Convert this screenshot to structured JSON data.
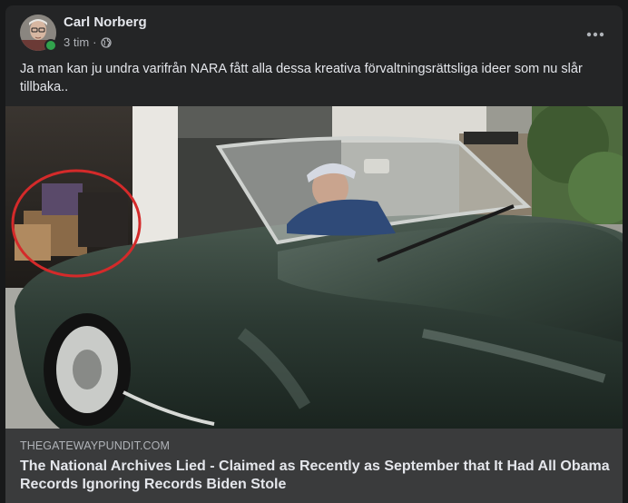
{
  "post": {
    "author": "Carl Norberg",
    "time": "3 tim",
    "separator": "·",
    "audience_icon": "globe-icon",
    "more_icon": "more-options-icon",
    "text": "Ja man kan ju undra varifrån NARA fått alla dessa kreativa förvaltningsrättsliga ideer som nu  slår tillbaka.."
  },
  "link_preview": {
    "domain": "THEGATEWAYPUNDIT.COM",
    "headline": "The National Archives Lied - Claimed as Recently as September that It Had All Obama Records Ignoring Records Biden Stole"
  },
  "colors": {
    "background": "#18191a",
    "card": "#242526",
    "link_preview_bg": "#3a3b3c",
    "online": "#31a24c",
    "annotation_circle": "#d42a2a"
  }
}
